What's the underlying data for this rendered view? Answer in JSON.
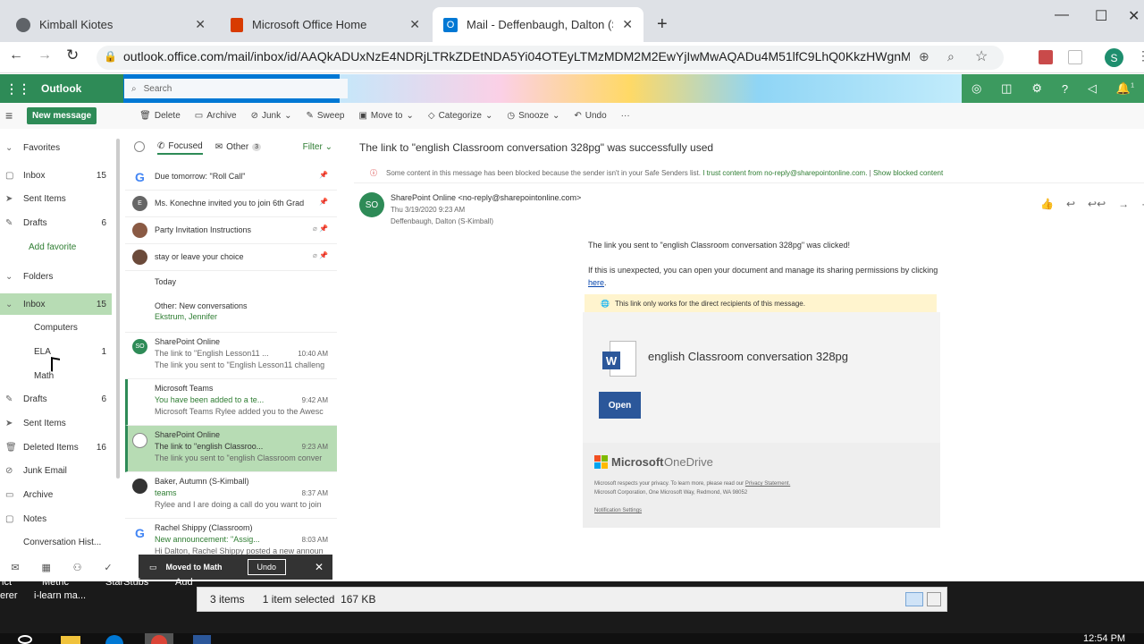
{
  "browser": {
    "tabs": [
      {
        "title": "Kimball Kiotes",
        "active": false
      },
      {
        "title": "Microsoft Office Home",
        "active": false
      },
      {
        "title": "Mail - Deffenbaugh, Dalton (S-Ki",
        "active": true
      }
    ],
    "url": "outlook.office.com/mail/inbox/id/AAQkADUxNzE4NDRjLTRkZDEtNDA5Yi04OTEyLTMzMDM2M2EwYjIwMwAQADu4M51lfC9LhQ0KkzHWgnM...",
    "profile_initial": "S"
  },
  "outlook": {
    "app_name": "Outlook",
    "search_placeholder": "Search",
    "new_message": "New message",
    "commands": [
      "Delete",
      "Archive",
      "Junk",
      "Sweep",
      "Move to",
      "Categorize",
      "Snooze",
      "Undo"
    ],
    "notification_count": "1"
  },
  "nav": {
    "favorites": "Favorites",
    "fav_items": [
      {
        "label": "Inbox",
        "count": "15"
      },
      {
        "label": "Sent Items",
        "count": ""
      },
      {
        "label": "Drafts",
        "count": "6"
      }
    ],
    "add_favorite": "Add favorite",
    "folders": "Folders",
    "inbox": {
      "label": "Inbox",
      "count": "15"
    },
    "subfolders": [
      {
        "label": "Computers",
        "count": ""
      },
      {
        "label": "ELA",
        "count": "1"
      },
      {
        "label": "Math",
        "count": ""
      }
    ],
    "folder_items": [
      {
        "label": "Drafts",
        "count": "6"
      },
      {
        "label": "Sent Items",
        "count": ""
      },
      {
        "label": "Deleted Items",
        "count": "16"
      },
      {
        "label": "Junk Email",
        "count": ""
      },
      {
        "label": "Archive",
        "count": ""
      },
      {
        "label": "Notes",
        "count": ""
      },
      {
        "label": "Conversation Hist...",
        "count": ""
      }
    ]
  },
  "list": {
    "focused": "Focused",
    "other": "Other",
    "other_count": "3",
    "filter": "Filter",
    "pinned": [
      "Due tomorrow: \"Roll Call\"",
      "Ms. Konechne invited you to join 6th Grad",
      "Party Invitation Instructions",
      "stay or leave your choice"
    ],
    "today": "Today",
    "other_conv": "Other: New conversations",
    "other_conv_from": "Ekstrum, Jennifer",
    "messages": [
      {
        "from": "SharePoint Online",
        "subject": "The link to \"English Lesson11 ...",
        "time": "10:40 AM",
        "preview": "The link you sent to \"English Lesson11 challeng"
      },
      {
        "from": "Microsoft Teams",
        "subject": "You have been added to a te...",
        "time": "9:42 AM",
        "preview": "Microsoft Teams Rylee added you to the Awesc"
      },
      {
        "from": "SharePoint Online",
        "subject": "The link to \"english Classroo...",
        "time": "9:23 AM",
        "preview": "The link you sent to \"english Classroom conver"
      },
      {
        "from": "Baker, Autumn (S-Kimball)",
        "subject": "teams",
        "time": "8:37 AM",
        "preview": "Rylee and I are doing a call do you want to join"
      },
      {
        "from": "Rachel Shippy (Classroom)",
        "subject": "New announcement: \"Assig...",
        "time": "8:03 AM",
        "preview": "Hi Dalton, Rachel Shippy posted a new announ"
      }
    ]
  },
  "reading": {
    "subject": "The link to \"english Classroom conversation 328pg\" was successfully used",
    "blocked_text": "Some content in this message has been blocked because the sender isn't in your Safe Senders list.",
    "trust_link": "I trust content from no-reply@sharepointonline.com.",
    "show_blocked": "Show blocked content",
    "sender_initials": "SO",
    "sender": "SharePoint Online <no-reply@sharepointonline.com>",
    "date": "Thu 3/19/2020 9:23 AM",
    "to": "Deffenbaugh, Dalton (S-Kimball)",
    "body1": "The link you sent to \"english Classroom conversation 328pg\" was clicked!",
    "body2": "If this is unexpected, you can open your document and manage its sharing permissions by clicking",
    "here": "here",
    "notice": "This link only works for the direct recipients of this message.",
    "doc_name": "english Classroom conversation 328pg",
    "open": "Open",
    "brand1": "Microsoft",
    "brand2": "OneDrive",
    "footer1": "Microsoft respects your privacy. To learn more, please read our",
    "privacy": "Privacy Statement.",
    "footer2": "Microsoft Corporation, One Microsoft Way, Redmond, WA 98052",
    "notif_settings": "Notification Settings"
  },
  "toast": {
    "text": "Moved to Math",
    "undo": "Undo"
  },
  "status": {
    "items": "3 items",
    "selected": "1 item selected",
    "size": "167 KB"
  },
  "taskbar": {
    "t1": "ict",
    "t2": "Metric",
    "t3": "StarStubs",
    "t4": "Aud",
    "t5": "erer",
    "t6": "i-learn ma...",
    "clock": "12:54 PM"
  },
  "colors": {
    "outlook_green": "#2e8b57",
    "selected_green": "#b7dcb4",
    "word_blue": "#2b579a"
  }
}
